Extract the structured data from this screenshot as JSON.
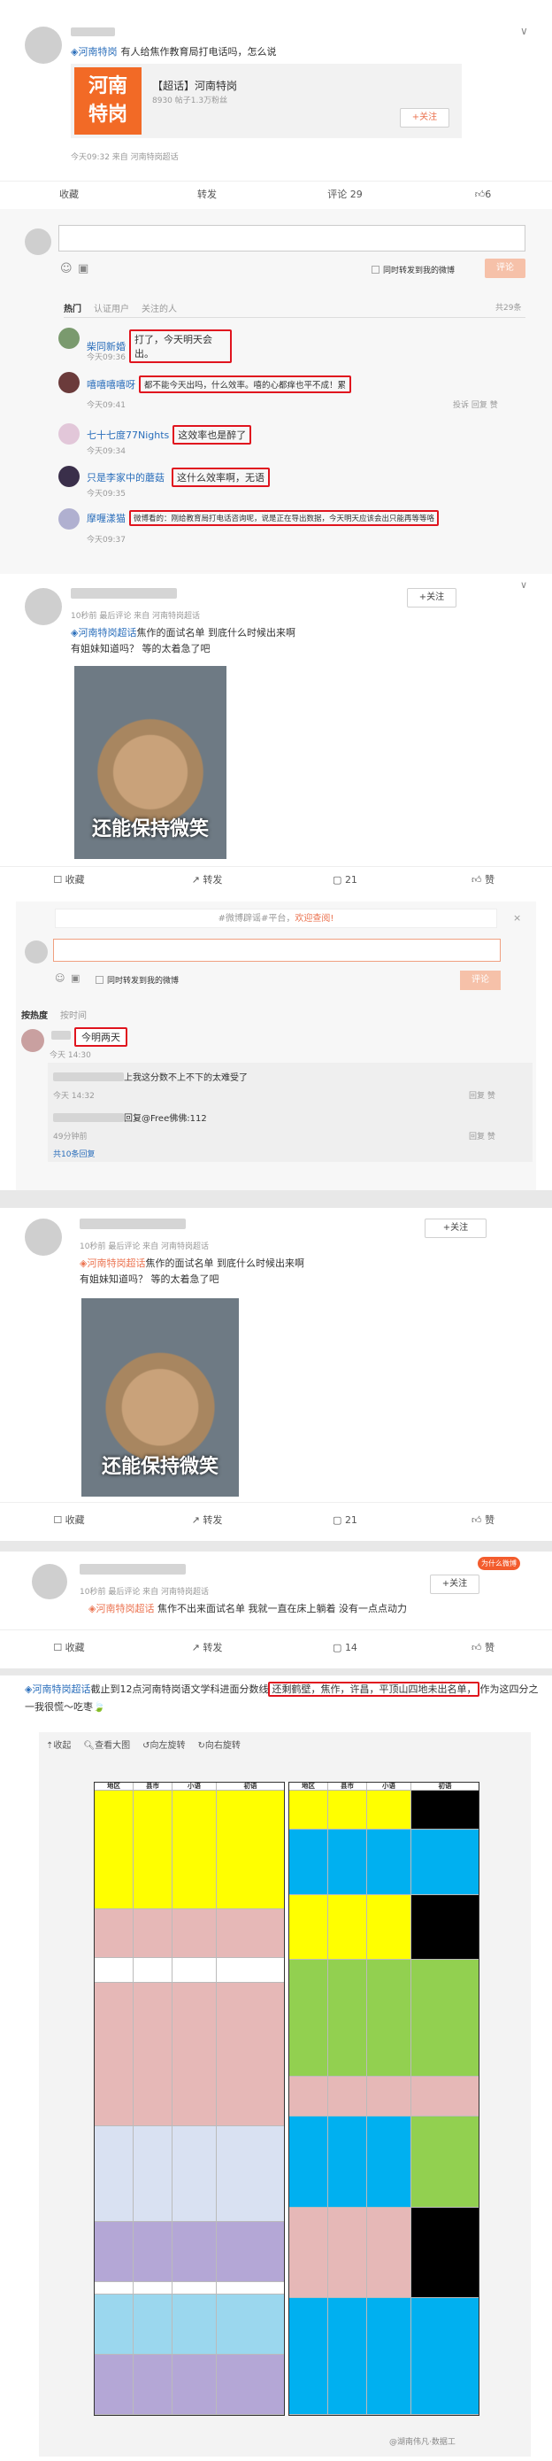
{
  "post1": {
    "source": "河南特岗",
    "text": "有人给焦作教育局打电话吗，怎么说",
    "text_highlight": "焦作",
    "card_logo_l1": "河南",
    "card_logo_l2": "特岗",
    "card_title": "【超话】河南特岗",
    "card_stats": "8930 帖子1.3万粉丝",
    "card_follow": "+关注",
    "meta": "今天09:32 来自 河南特岗超话",
    "actions": {
      "fav": "收藏",
      "share": "转发",
      "comment": "评论 29",
      "like": "6"
    },
    "comment_check": "同时转发到我的微博",
    "comment_btn": "评论",
    "tabs": [
      "热门",
      "认证用户",
      "关注的人"
    ],
    "count": "共29条",
    "comments": [
      {
        "name": "柴同新婚",
        "text": "打了，今天明天会出。",
        "time": "今天09:36"
      },
      {
        "name": "嘻嘻嘻嘻呀",
        "text": "都不能今天出吗，什么效率。嘻的心都痒也平不成！累",
        "time": "今天09:41",
        "extra": "投诉  回复  赞"
      },
      {
        "name": "七十七度77Nights",
        "text": "这效率也是醉了",
        "time": "今天09:34"
      },
      {
        "name": "只是李家中的蘑菇",
        "text": "这什么效率啊，无语",
        "time": "今天09:35"
      },
      {
        "name": "摩喱漾猫",
        "text": "微博看的：刚给教育局打电话咨询呢，说是正在导出数据，今天明天应该会出只能再等等咯",
        "time": "今天09:37"
      }
    ]
  },
  "post2": {
    "meta": "10秒前 最后评论 来自 河南特岗超话",
    "source": "河南特岗超话",
    "text": "焦作的面试名单 到底什么时候出来啊",
    "text2": "有姐妹知道吗？ 等的太着急了吧",
    "follow": "+关注",
    "image_caption": "还能保持微笑",
    "actions": {
      "fav": "收藏",
      "share": "转发",
      "comment": "21",
      "like": "赞"
    },
    "notice": "#微博辟谣#平台，欢迎查阅!",
    "notice_link": "#微博辟谣#平台，",
    "notice_text": "欢迎查阅!",
    "check": "同时转发到我的微博",
    "btn": "评论",
    "sort": [
      "按热度",
      "按时间"
    ],
    "c1_text": "今明两天",
    "c1_time": "今天 14:30",
    "reply1_text": "上我这分数不上不下的太难受了",
    "reply1_time": "今天 14:32",
    "reply2_user": "@Free佛佛",
    "reply2_text": "回复@Free佛佛:112",
    "reply2_time": "49分钟前",
    "more": "共10条回复",
    "reply_actions": "回复  赞"
  },
  "post3": {
    "meta": "10秒前 最后评论 来自 河南特岗超话",
    "source": "河南特岗超话",
    "text": "焦作的面试名单 到底什么时候出来啊",
    "text2": "有姐妹知道吗？ 等的太着急了吧",
    "follow": "+关注",
    "image_caption": "还能保持微笑",
    "actions": {
      "fav": "收藏",
      "share": "转发",
      "comment": "21",
      "like": "赞"
    }
  },
  "post4": {
    "meta": "10秒前 最后评论 来自 河南特岗超话",
    "source": "河南特岗超话",
    "text": "焦作不出来面试名单 我就一直在床上躺着 没有一点点动力",
    "follow": "+关注",
    "badge": "为什么微博",
    "actions": {
      "fav": "收藏",
      "share": "转发",
      "comment": "14",
      "like": "赞"
    }
  },
  "post5": {
    "source": "河南特岗超话",
    "text_a": "截止到12点河南特岗语文学科进面分数线",
    "text_b": "还剩鹤壁，焦作，许昌，平顶山四地未出名单，",
    "text_c": "作为这四分之一我很慌～吃枣🍃",
    "toolbar": [
      "收起",
      "查看大图",
      "向左旋转",
      "向右旋转"
    ],
    "table_headers": [
      "地区",
      "县市",
      "小语",
      "初语"
    ],
    "watermark": "@湖南伟凡·数据工"
  },
  "colors": {
    "accent": "#eb7350",
    "link": "#2a6ebb",
    "red": "#e0141e",
    "yellow": "#ffff00",
    "green": "#92d050",
    "blue": "#00b0f0",
    "pink": "#e6b8b7",
    "purple": "#b4a7d6"
  }
}
